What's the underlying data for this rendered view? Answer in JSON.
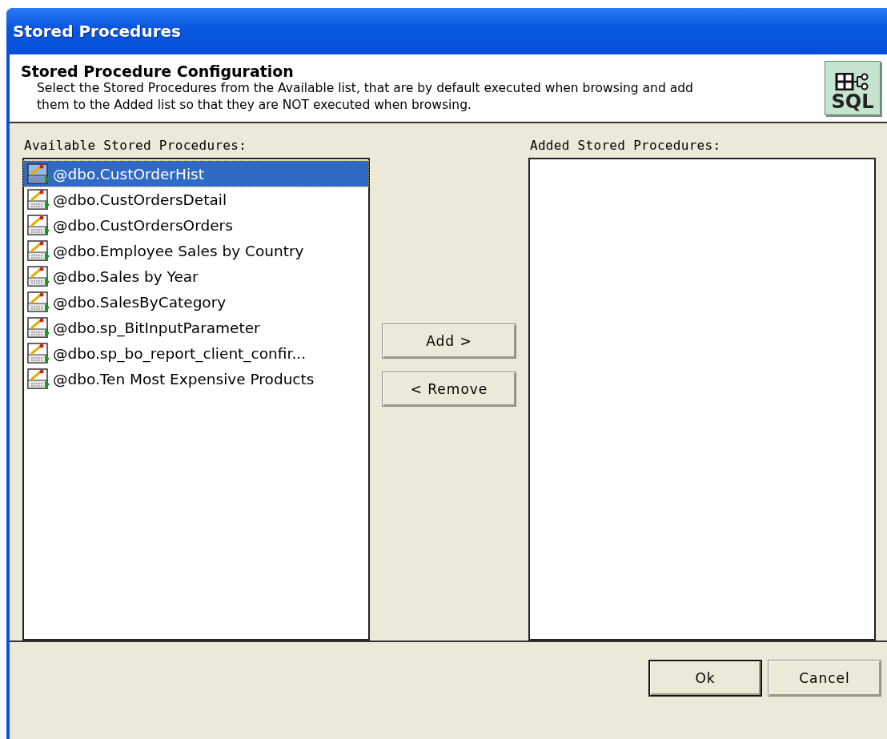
{
  "window": {
    "title": "Stored Procedures"
  },
  "header": {
    "title": "Stored Procedure Configuration",
    "description": "Select the Stored Procedures from the Available list, that are by default executed when browsing and add them to the Added list so that they are NOT executed when browsing.",
    "badge": "SQL"
  },
  "available": {
    "label": "Available Stored Procedures:",
    "items": [
      {
        "name": "@dbo.CustOrderHist",
        "selected": true
      },
      {
        "name": "@dbo.CustOrdersDetail",
        "selected": false
      },
      {
        "name": "@dbo.CustOrdersOrders",
        "selected": false
      },
      {
        "name": "@dbo.Employee Sales by Country",
        "selected": false
      },
      {
        "name": "@dbo.Sales by Year",
        "selected": false
      },
      {
        "name": "@dbo.SalesByCategory",
        "selected": false
      },
      {
        "name": "@dbo.sp_BitInputParameter",
        "selected": false
      },
      {
        "name": "@dbo.sp_bo_report_client_confir...",
        "selected": false
      },
      {
        "name": "@dbo.Ten Most Expensive Products",
        "selected": false
      }
    ]
  },
  "move_buttons": [
    "Add >",
    "< Remove"
  ],
  "added": {
    "label": "Added Stored Procedures:"
  },
  "footer_buttons": [
    {
      "label": "Ok",
      "default": true
    },
    {
      "label": "Cancel",
      "default": false
    }
  ]
}
